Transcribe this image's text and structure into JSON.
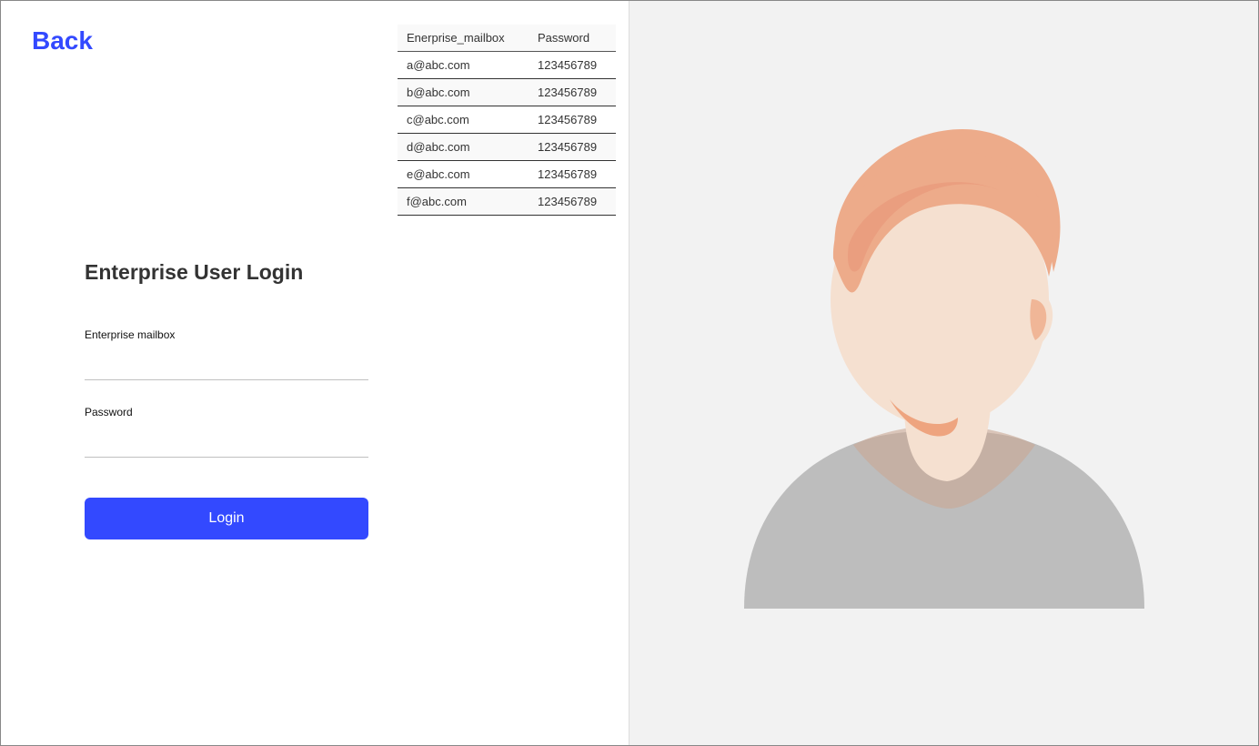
{
  "back": {
    "label": "Back"
  },
  "table": {
    "columns": {
      "email": "Enerprise_mailbox",
      "password": "Password"
    },
    "rows": [
      {
        "email": "a@abc.com",
        "password": "123456789"
      },
      {
        "email": "b@abc.com",
        "password": "123456789"
      },
      {
        "email": "c@abc.com",
        "password": "123456789"
      },
      {
        "email": "d@abc.com",
        "password": "123456789"
      },
      {
        "email": "e@abc.com",
        "password": "123456789"
      },
      {
        "email": "f@abc.com",
        "password": "123456789"
      }
    ]
  },
  "form": {
    "title": "Enterprise User Login",
    "email_label": "Enterprise mailbox",
    "password_label": "Password",
    "login_label": "Login"
  },
  "colors": {
    "accent": "#3349ff"
  }
}
